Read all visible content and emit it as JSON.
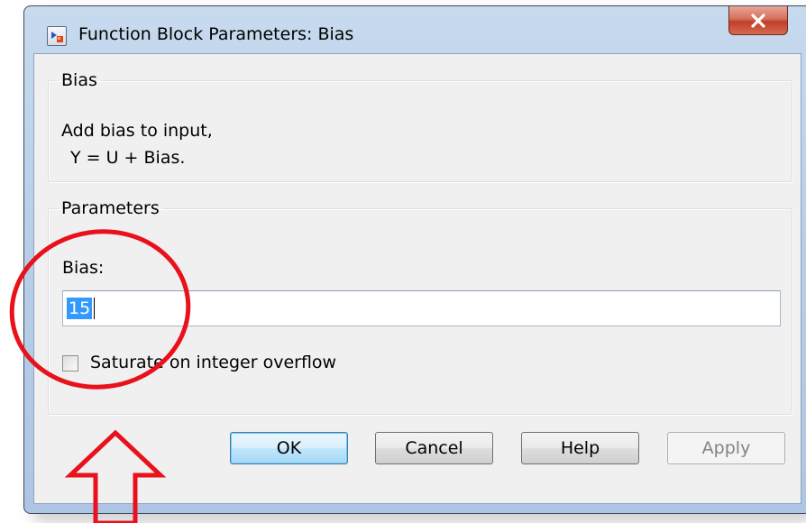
{
  "window": {
    "title": "Function Block Parameters: Bias",
    "icon": "simulink-block-icon"
  },
  "description_group": {
    "legend": "Bias",
    "lines": [
      "Add bias to input,",
      "Y = U + Bias."
    ]
  },
  "parameters_group": {
    "legend": "Parameters",
    "bias_label": "Bias:",
    "bias_value": "15",
    "saturate_label": "Saturate on integer overflow",
    "saturate_checked": false
  },
  "buttons": {
    "ok": "OK",
    "cancel": "Cancel",
    "help": "Help",
    "apply": "Apply"
  },
  "annotation": {
    "color": "#e8111c"
  }
}
